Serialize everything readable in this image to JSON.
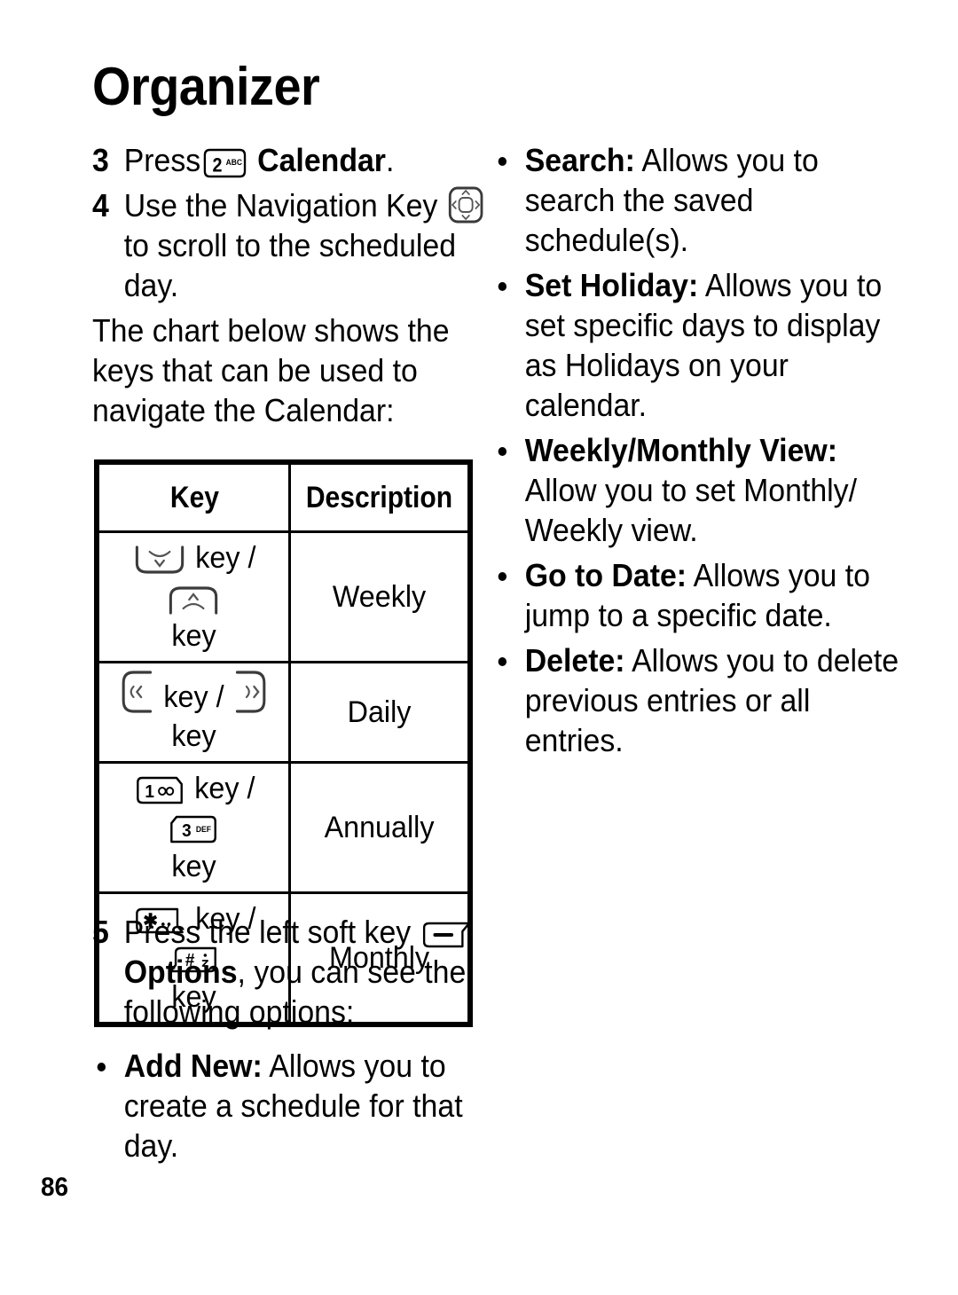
{
  "page": {
    "title": "Organizer",
    "number": "86"
  },
  "left_column": {
    "step3": {
      "num": "3",
      "text_before": "Press",
      "icon": "key-2-abc",
      "text_after": "Calendar",
      "period": "."
    },
    "step4": {
      "num": "4",
      "text_before": "Use the Navigation Key",
      "icon": "navigation-key",
      "text_after": "to scroll to the scheduled day."
    },
    "paragraph": "The chart below shows the keys that can be used to navigate the Calendar:",
    "step5": {
      "num": "5",
      "text_before": "Press the left soft key",
      "icon": "left-soft-key",
      "bold_text": "Options",
      "text_after": ", you can see the following options:"
    },
    "bullets": [
      {
        "label": "Add New:",
        "text": "Allows you to create a schedule for that day."
      }
    ]
  },
  "table": {
    "headers": [
      "Key",
      "Description"
    ],
    "rows": [
      {
        "icon_left": "nav-down-key",
        "sep_before": "key /",
        "icon_right": "nav-up-key",
        "sep_after": "key",
        "description": "Weekly"
      },
      {
        "icon_left": "nav-left-key",
        "sep_before": "key /",
        "icon_right": "nav-right-key",
        "sep_after": "key",
        "description": "Daily"
      },
      {
        "icon_left": "key-1-voicemail",
        "sep_before": "key /",
        "icon_right": "key-3-def",
        "sep_after": "key",
        "description": "Annually"
      },
      {
        "icon_left": "key-star",
        "sep_before": "key /",
        "icon_right": "key-pound",
        "sep_after": "key",
        "description": "Monthly"
      }
    ]
  },
  "right_column": {
    "bullets": [
      {
        "label": "Search:",
        "text": "Allows you to search the saved schedule(s)."
      },
      {
        "label": "Set Holiday:",
        "text": "Allows you to set specific days to display as Holidays on your calendar."
      },
      {
        "label": "Weekly/Monthly View:",
        "text": "Allow you to set Monthly/ Weekly view."
      },
      {
        "label": "Go to Date:",
        "text": "Allows you to jump to a specific date."
      },
      {
        "label": "Delete:",
        "text": "Allows you to delete previous entries or all entries."
      }
    ]
  },
  "colors": {
    "text": "#000000",
    "background": "#ffffff",
    "border": "#000000"
  }
}
